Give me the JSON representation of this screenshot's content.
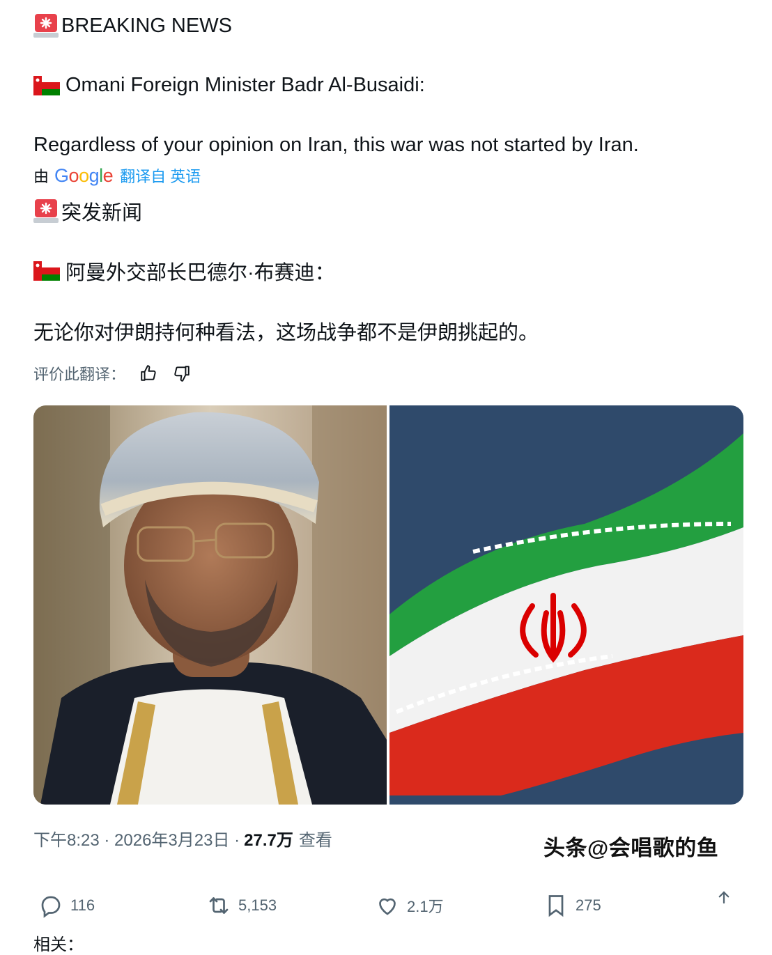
{
  "post": {
    "line1": "BREAKING NEWS",
    "line2": "Omani Foreign Minister Badr Al-Busaidi:",
    "line3": "Regardless of your opinion on Iran, this war was not started by Iran.",
    "translation": {
      "by_label": "由",
      "provider": "Google",
      "translated_from": "翻译自 英语"
    },
    "zh_line1": "突发新闻",
    "zh_line2": "阿曼外交部长巴德尔·布赛迪：",
    "zh_line3": "无论你对伊朗持何种看法，这场战争都不是伊朗挑起的。",
    "rate_label": "评价此翻译："
  },
  "meta": {
    "time_date": "下午8:23 · 2026年3月23日 · ",
    "views_count": "27.7万",
    "views_label": "查看"
  },
  "watermark": "头条@会唱歌的鱼",
  "actions": {
    "replies": "116",
    "reposts": "5,153",
    "likes": "2.1万",
    "bookmarks": "275"
  },
  "related_label": "相关：",
  "colors": {
    "accent": "#1d9bf0",
    "muted": "#536471",
    "oman_red": "#db161b",
    "oman_green": "#008000",
    "iran_green": "#239f40",
    "iran_red": "#da0000"
  },
  "icons": [
    "siren-icon",
    "oman-flag-icon",
    "thumbs-up-icon",
    "thumbs-down-icon",
    "reply-icon",
    "repost-icon",
    "like-icon",
    "bookmark-icon",
    "share-icon"
  ]
}
